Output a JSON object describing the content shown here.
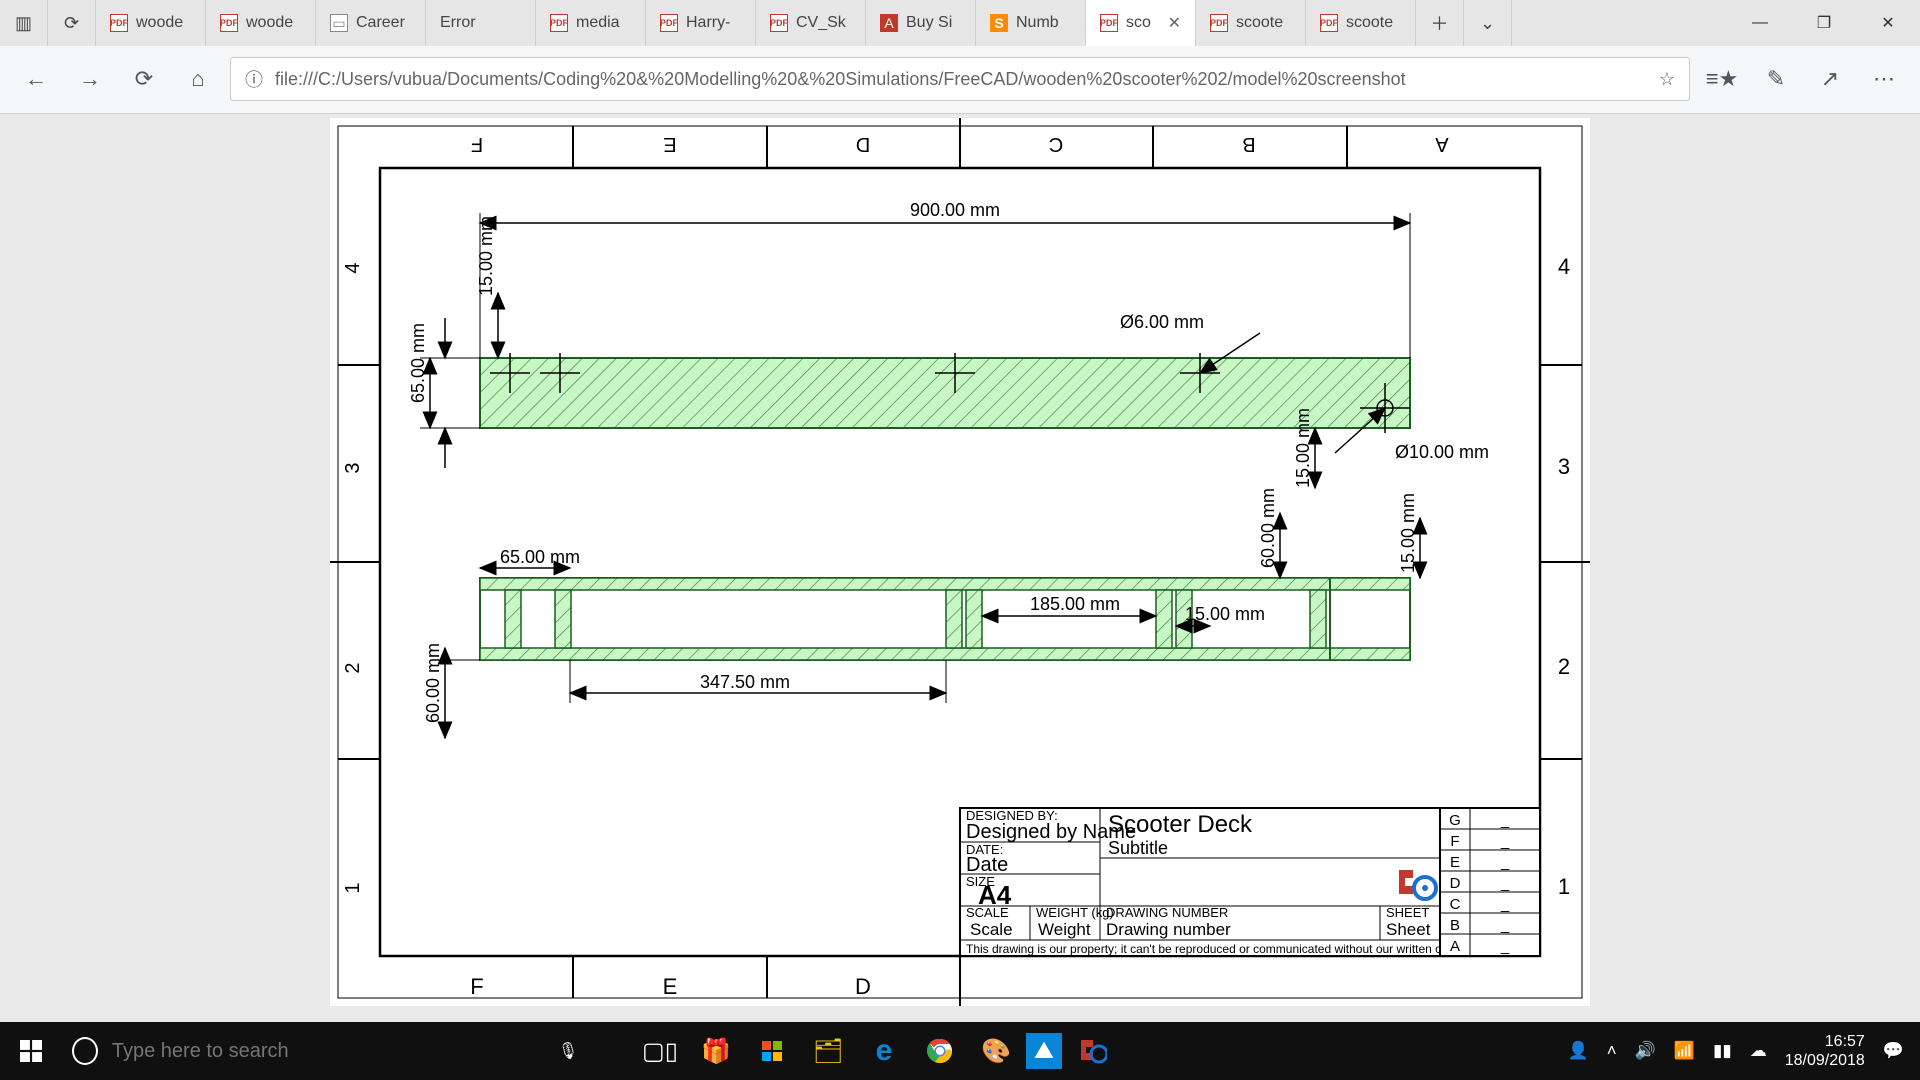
{
  "browser": {
    "tabs": [
      {
        "fav": "pdf",
        "label": "woode"
      },
      {
        "fav": "pdf",
        "label": "woode"
      },
      {
        "fav": "none",
        "label": "Career"
      },
      {
        "fav": "",
        "label": "Error"
      },
      {
        "fav": "pdf",
        "label": "media"
      },
      {
        "fav": "pdf",
        "label": "Harry-"
      },
      {
        "fav": "pdf",
        "label": "CV_Sk"
      },
      {
        "fav": "a",
        "label": "Buy Si"
      },
      {
        "fav": "s",
        "label": "Numb"
      },
      {
        "fav": "pdf",
        "label": "sco",
        "active": true,
        "closable": true
      },
      {
        "fav": "pdf",
        "label": "scoote"
      },
      {
        "fav": "pdf",
        "label": "scoote"
      }
    ],
    "url": "file:///C:/Users/vubua/Documents/Coding%20&%20Modelling%20&%20Simulations/FreeCAD/wooden%20scooter%202/model%20screenshot"
  },
  "drawing": {
    "frame": {
      "cols_top": [
        "F",
        "E",
        "D",
        "C",
        "B",
        "A"
      ],
      "cols_bottom": [
        "F",
        "E",
        "D"
      ],
      "rows_left": [
        "4",
        "3",
        "2",
        "1"
      ],
      "rows_right": [
        "4",
        "3",
        "2",
        "1"
      ]
    },
    "dims": {
      "d_900": "900.00 mm",
      "d_15a": "15.00 mm",
      "d_65a": "65.00 mm",
      "d_phi6": "Ø6.00 mm",
      "d_phi10": "Ø10.00 mm",
      "d_15b": "15.00 mm",
      "d_60b": "60.00 mm",
      "d_15c": "15.00 mm",
      "d_65b": "65.00 mm",
      "d_347": "347.50 mm",
      "d_185": "185.00 mm",
      "d_15d": "15.00 mm",
      "d_60c": "60.00 mm"
    },
    "title_block": {
      "designed_by_lbl": "DESIGNED BY:",
      "designed_by": "Designed by Name",
      "date_lbl": "DATE:",
      "date": "Date",
      "size_lbl": "SIZE",
      "size": "A4",
      "scale_lbl": "SCALE",
      "scale": "Scale",
      "weight_lbl": "WEIGHT (kg)",
      "weight": "Weight",
      "drwno_lbl": "DRAWING NUMBER",
      "drwno": "Drawing number",
      "sheet_lbl": "SHEET",
      "sheet": "Sheet",
      "title": "Scooter Deck",
      "subtitle": "Subtitle",
      "rev_letters": [
        "G",
        "F",
        "E",
        "D",
        "C",
        "B",
        "A"
      ],
      "rev_dash": "_",
      "disclaimer": "This drawing is our property; it can't be reproduced or communicated without our written consent."
    }
  },
  "taskbar": {
    "search_placeholder": "Type here to search",
    "time": "16:57",
    "date": "18/09/2018"
  }
}
